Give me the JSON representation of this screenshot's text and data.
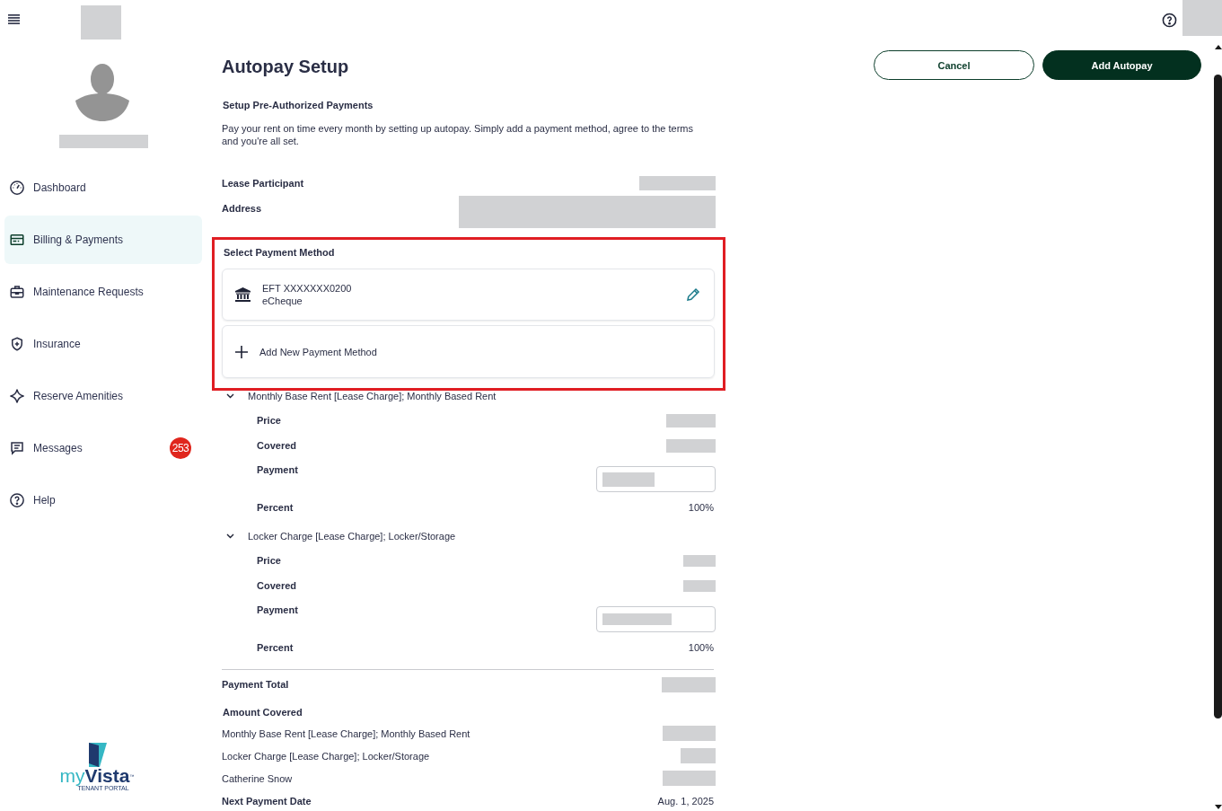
{
  "sidebar": {
    "items": [
      {
        "label": "Dashboard",
        "selected": false
      },
      {
        "label": "Billing & Payments",
        "selected": true
      },
      {
        "label": "Maintenance Requests",
        "selected": false
      },
      {
        "label": "Insurance",
        "selected": false
      },
      {
        "label": "Reserve Amenities",
        "selected": false
      },
      {
        "label": "Messages",
        "selected": false,
        "badge": "253"
      },
      {
        "label": "Help",
        "selected": false
      }
    ],
    "logo": {
      "prefix": "my",
      "name": "Vista",
      "mark": "™",
      "tagline": "TENANT PORTAL"
    }
  },
  "page": {
    "title": "Autopay Setup",
    "subtitle": "Setup Pre-Authorized Payments",
    "intro": "Pay your rent on time every month by setting up autopay. Simply add a payment method, agree to the terms and you're all set."
  },
  "actions": [
    {
      "label": "Cancel",
      "kind": "secondary"
    },
    {
      "label": "Add Autopay",
      "kind": "primary"
    }
  ],
  "details": [
    {
      "label": "Lease Participant",
      "kind": "short"
    },
    {
      "label": "Address",
      "kind": "long"
    }
  ],
  "payment_method": {
    "title": "Select Payment Method",
    "highlighted": true,
    "options": [
      {
        "kind": "account",
        "title": "EFT XXXXXXX0200",
        "subtitle": "eCheque"
      },
      {
        "kind": "add",
        "title": "Add New Payment Method"
      }
    ]
  },
  "charges": [
    {
      "name": "Monthly Base Rent [Lease Charge]; Monthly Based Rent",
      "expanded": true,
      "rows": [
        {
          "label": "Price",
          "kind": "hidden"
        },
        {
          "label": "Covered",
          "kind": "hidden"
        },
        {
          "label": "Payment",
          "kind": "input"
        },
        {
          "label": "Percent",
          "kind": "text",
          "value": "100%"
        }
      ]
    },
    {
      "name": "Locker Charge [Lease Charge]; Locker/Storage",
      "expanded": true,
      "rows": [
        {
          "label": "Price",
          "kind": "hidden"
        },
        {
          "label": "Covered",
          "kind": "hidden"
        },
        {
          "label": "Payment",
          "kind": "input"
        },
        {
          "label": "Percent",
          "kind": "text",
          "value": "100%"
        }
      ]
    }
  ],
  "payment_total": {
    "label": "Payment Total"
  },
  "amount_covered": {
    "title": "Amount Covered",
    "items": [
      {
        "label": "Monthly Base Rent [Lease Charge]; Monthly Based Rent"
      },
      {
        "label": "Locker Charge [Lease Charge]; Locker/Storage"
      },
      {
        "label": "Catherine Snow"
      }
    ]
  },
  "next_payment": {
    "label": "Next Payment Date",
    "value": "Aug. 1, 2025"
  }
}
